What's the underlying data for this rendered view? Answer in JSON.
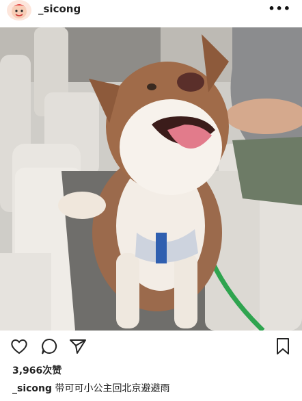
{
  "post": {
    "username": "_sicong",
    "more_label": "•••",
    "likes_text": "3,966次赞",
    "caption": {
      "user": "_sicong",
      "text": " 带可可小公主回北京避避雨"
    }
  },
  "icons": {
    "avatar": "cartoon-avatar-icon",
    "like": "heart-icon",
    "comment": "comment-bubble-icon",
    "share": "paper-plane-icon",
    "save": "bookmark-icon",
    "more": "more-dots-icon"
  },
  "colors": {
    "text": "#222222",
    "accent_green_leash": "#2fa44f",
    "harness_blue": "#2f5fb0"
  }
}
